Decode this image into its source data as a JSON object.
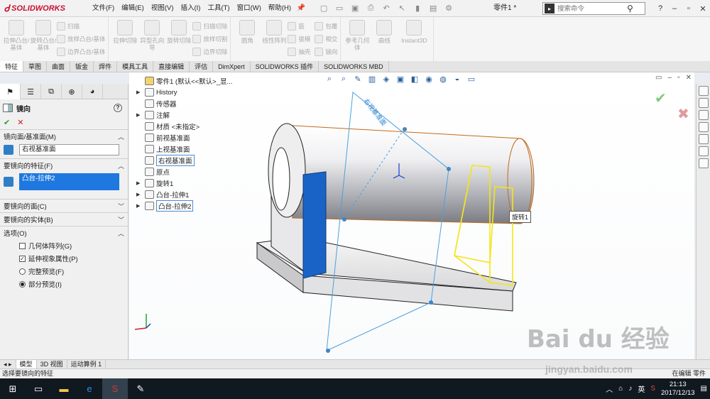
{
  "app": {
    "logo_text": "SOLIDWORKS",
    "doc_title": "零件1 *",
    "menus": [
      "文件(F)",
      "编辑(E)",
      "视图(V)",
      "插入(I)",
      "工具(T)",
      "窗口(W)",
      "帮助(H)"
    ],
    "search_placeholder": "搜索命令",
    "help_icon": "?"
  },
  "ribbon": {
    "big1": "拉伸凸台/基体",
    "big2": "旋转凸台/基体",
    "small1": [
      "扫描",
      "放样凸台/基体",
      "边界凸台/基体"
    ],
    "big3": "拉伸切除",
    "big4": "异型孔向导",
    "big5": "旋转切除",
    "small2": [
      "扫描切除",
      "放样切割",
      "边界切除"
    ],
    "big6": "圆角",
    "big7": "线性阵列",
    "small3": [
      "筋",
      "拔模",
      "抽壳"
    ],
    "small4": [
      "包覆",
      "相交",
      "镜向"
    ],
    "big8": "参考几何体",
    "big9": "曲线",
    "big10": "Instant3D"
  },
  "cm_tabs": [
    "特征",
    "草图",
    "曲面",
    "钣金",
    "焊件",
    "模具工具",
    "直接编辑",
    "评估",
    "DimXpert",
    "SOLIDWORKS 插件",
    "SOLIDWORKS MBD"
  ],
  "property_manager": {
    "title": "镜向",
    "ok": "✔",
    "cancel": "✕",
    "sections": {
      "mirror_face": {
        "header": "镜向面/基准面(M)",
        "value": "右视基准面"
      },
      "features": {
        "header": "要镜向的特征(F)",
        "value": "凸台-拉伸2"
      },
      "faces": {
        "header": "要镜向的面(C)"
      },
      "bodies": {
        "header": "要镜向的实体(B)"
      },
      "options": {
        "header": "选项(O)",
        "items": [
          "几何体阵列(G)",
          "延伸视象属性(P)",
          "完整预览(F)",
          "部分预览(I)"
        ]
      }
    }
  },
  "tree": {
    "root": "零件1 (默认<<默认>_显...",
    "items": [
      "History",
      "传感器",
      "注解",
      "材质 <未指定>",
      "前视基准面",
      "上视基准面",
      "右视基准面",
      "原点",
      "旋转1",
      "凸台-拉伸1",
      "凸台-拉伸2"
    ]
  },
  "viewport": {
    "plane_label": "右视基准面",
    "tooltip": "旋转1"
  },
  "bottom_tabs": [
    "模型",
    "3D 视图",
    "运动算例 1"
  ],
  "status": {
    "message": "选择要镜向的特征",
    "right": "在编辑 零件"
  },
  "taskbar": {
    "time": "21:13",
    "date": "2017/12/13",
    "ime": "英"
  },
  "watermark": {
    "line1": "Bai du 经验",
    "line2": "jingyan.baidu.com"
  }
}
